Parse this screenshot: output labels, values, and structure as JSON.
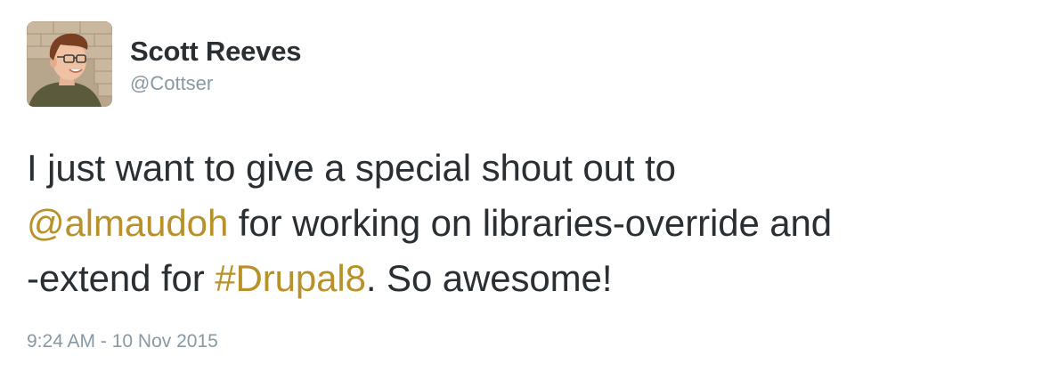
{
  "author": {
    "display_name": "Scott Reeves",
    "handle": "@Cottser",
    "avatar": "profile-photo"
  },
  "tweet": {
    "line1": "I just want to give a special shout out to",
    "mention": "@almaudoh",
    "after_mention": " for working on libraries-override and",
    "line3_start": "-extend for ",
    "hashtag": "#Drupal8",
    "line3_end": ". So awesome!"
  },
  "timestamp": "9:24 AM - 10 Nov 2015",
  "colors": {
    "link": "#b8912a",
    "text": "#292f33",
    "muted": "#8899a6"
  }
}
